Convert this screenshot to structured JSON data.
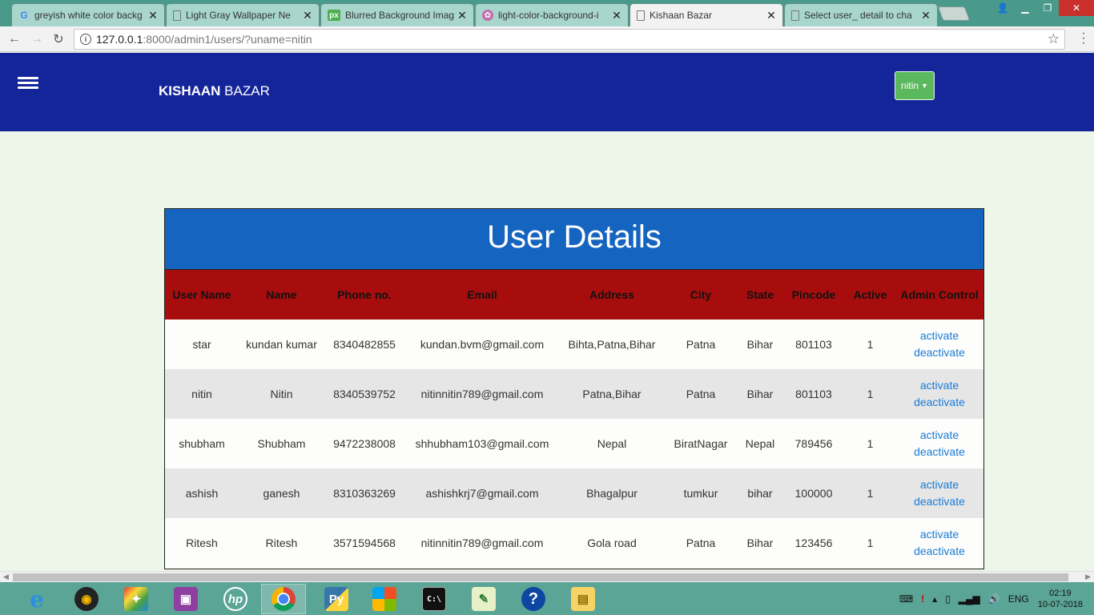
{
  "browser": {
    "tabs": [
      {
        "title": "greyish white color backg",
        "icon": "google-icon"
      },
      {
        "title": "Light Gray Wallpaper Ne",
        "icon": "page-icon"
      },
      {
        "title": "Blurred Background Imag",
        "icon": "px-icon"
      },
      {
        "title": "light-color-background-i",
        "icon": "flower-icon"
      },
      {
        "title": "Kishaan Bazar",
        "icon": "page-icon"
      },
      {
        "title": "Select user_ detail to cha",
        "icon": "page-icon"
      }
    ],
    "active_tab": 4,
    "url_host": "127.0.0.1",
    "url_path": ":8000/admin1/users/?uname=nitin"
  },
  "navbar": {
    "brand_bold": "KISHAAN",
    "brand_rest": " BAZAR",
    "user_button": "nitin"
  },
  "panel": {
    "title": "User Details",
    "columns": [
      "User Name",
      "Name",
      "Phone no.",
      "Email",
      "Address",
      "City",
      "State",
      "Pincode",
      "Active",
      "Admin Control"
    ],
    "rows": [
      {
        "username": "star",
        "name": "kundan kumar",
        "phone": "8340482855",
        "email": "kundan.bvm@gmail.com",
        "address": "Bihta,Patna,Bihar",
        "city": "Patna",
        "state": "Bihar",
        "pincode": "801103",
        "active": "1"
      },
      {
        "username": "nitin",
        "name": "Nitin",
        "phone": "8340539752",
        "email": "nitinnitin789@gmail.com",
        "address": "Patna,Bihar",
        "city": "Patna",
        "state": "Bihar",
        "pincode": "801103",
        "active": "1"
      },
      {
        "username": "shubham",
        "name": "Shubham",
        "phone": "9472238008",
        "email": "shhubham103@gmail.com",
        "address": "Nepal",
        "city": "BiratNagar",
        "state": "Nepal",
        "pincode": "789456",
        "active": "1"
      },
      {
        "username": "ashish",
        "name": "ganesh",
        "phone": "8310363269",
        "email": "ashishkrj7@gmail.com",
        "address": "Bhagalpur",
        "city": "tumkur",
        "state": "bihar",
        "pincode": "100000",
        "active": "1"
      },
      {
        "username": "Ritesh",
        "name": "Ritesh",
        "phone": "3571594568",
        "email": "nitinnitin789@gmail.com",
        "address": "Gola road",
        "city": "Patna",
        "state": "Bihar",
        "pincode": "123456",
        "active": "1"
      }
    ],
    "activate_label": "activate",
    "deactivate_label": "deactivate"
  },
  "taskbar": {
    "apps": [
      "internet-explorer-icon",
      "media-player-icon",
      "games-icon",
      "connect-icon",
      "hp-icon",
      "chrome-icon",
      "python-icon",
      "office-icon",
      "terminal-icon",
      "notepad-icon",
      "help-icon",
      "file-explorer-icon"
    ],
    "language": "ENG",
    "time": "02:19",
    "date": "10-07-2018"
  },
  "colors": {
    "navbar": "#14259a",
    "panel_title": "#1565c0",
    "table_header": "#a70d0d",
    "user_button": "#5cb85c",
    "link": "#1a7bd6"
  }
}
